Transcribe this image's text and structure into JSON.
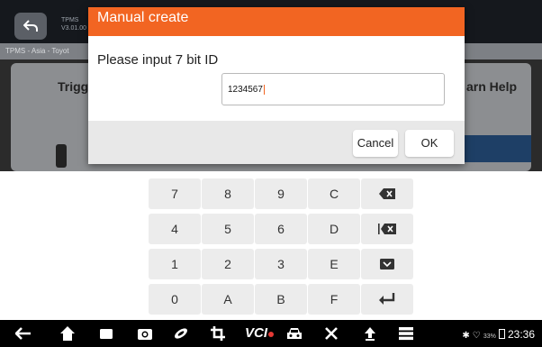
{
  "app": {
    "name_line1": "TPMS",
    "name_line2": "V3.01.00",
    "breadcrumb": "TPMS - Asia - Toyot",
    "trigger_label": "Trigge",
    "learn_help_label": "arn Help"
  },
  "dialog": {
    "title": "Manual create",
    "prompt": "Please input 7 bit ID",
    "input_value": "1234567",
    "cancel_label": "Cancel",
    "ok_label": "OK",
    "accent_color": "#f26522"
  },
  "keypad": {
    "rows": [
      [
        "7",
        "8",
        "9",
        "C"
      ],
      [
        "4",
        "5",
        "6",
        "D"
      ],
      [
        "1",
        "2",
        "3",
        "E"
      ],
      [
        "0",
        "A",
        "B",
        "F"
      ]
    ],
    "side_keys": [
      "backspace-icon",
      "delete-all-icon",
      "hide-keyboard-icon",
      "enter-icon"
    ]
  },
  "navbar": {
    "icons": [
      "back-icon",
      "home-icon",
      "recent-apps-icon",
      "camera-icon",
      "diagnose-icon",
      "crop-icon",
      "vci-icon",
      "car-icon",
      "tools-icon",
      "upload-icon",
      "menu-icon"
    ],
    "vci_label": "VCI",
    "battery": "33%",
    "time": "23:36"
  }
}
